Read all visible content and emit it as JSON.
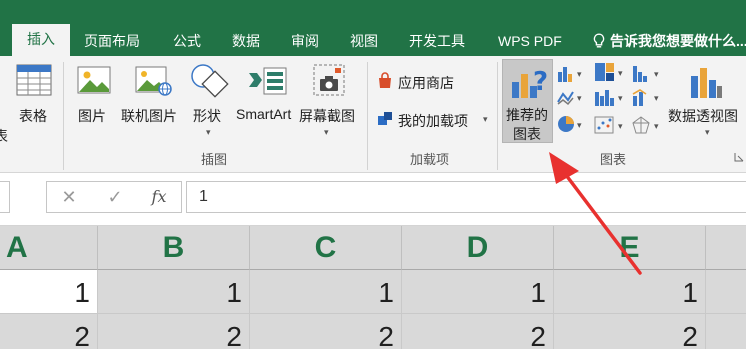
{
  "tabs": [
    {
      "label": "插入",
      "active": true
    },
    {
      "label": "页面布局"
    },
    {
      "label": "公式"
    },
    {
      "label": "数据"
    },
    {
      "label": "审阅"
    },
    {
      "label": "视图"
    },
    {
      "label": "开发工具"
    },
    {
      "label": "WPS PDF"
    },
    {
      "label": "告诉我您想要做什么..."
    }
  ],
  "ribbon": {
    "partial_left_label": "表",
    "table_label": "表格",
    "illustrations": {
      "group_label": "插图",
      "pictures": "图片",
      "online_pictures": "联机图片",
      "shapes": "形状",
      "smartart": "SmartArt",
      "screenshot": "屏幕截图"
    },
    "addins": {
      "group_label": "加载项",
      "store": "应用商店",
      "my_addins": "我的加载项"
    },
    "charts": {
      "group_label": "图表",
      "recommended_line1": "推荐的",
      "recommended_line2": "图表",
      "pivot_chart": "数据透视图"
    }
  },
  "formula_bar": {
    "cancel_symbol": "✕",
    "enter_symbol": "✓",
    "fx_symbol": "fx",
    "value": "1"
  },
  "grid": {
    "columns": [
      "A",
      "B",
      "C",
      "D",
      "E"
    ],
    "rows": [
      [
        "1",
        "1",
        "1",
        "1",
        "1"
      ],
      [
        "2",
        "2",
        "2",
        "2",
        "2"
      ]
    ]
  },
  "colors": {
    "brand_green": "#217346",
    "annotation_red": "#e8312f"
  }
}
